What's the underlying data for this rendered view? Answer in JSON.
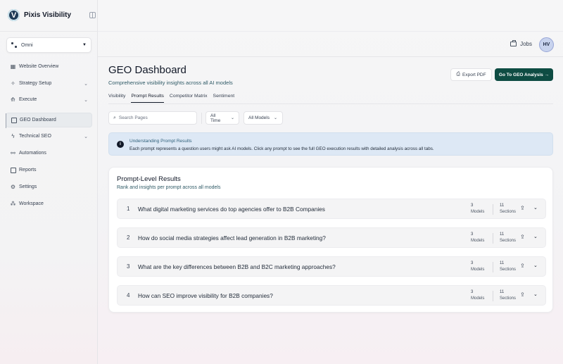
{
  "app": {
    "name": "Pixis Visibility",
    "logo_letter": "V"
  },
  "sidebar": {
    "org": {
      "name": "Omni"
    },
    "items": [
      {
        "label": "Website Overview",
        "icon": "grid-icon"
      },
      {
        "label": "Strategy Setup",
        "icon": "wand-icon",
        "expandable": true
      },
      {
        "label": "Execute",
        "icon": "rocket-icon",
        "expandable": true
      },
      {
        "label": "GEO Dashboard",
        "icon": "dashboard-icon",
        "active": true
      },
      {
        "label": "Technical SEO",
        "icon": "bolt-icon",
        "expandable": true
      },
      {
        "label": "Automations",
        "icon": "automation-icon"
      },
      {
        "label": "Reports",
        "icon": "reports-icon"
      },
      {
        "label": "Settings",
        "icon": "gear-icon"
      },
      {
        "label": "Workspace",
        "icon": "workspace-icon"
      }
    ]
  },
  "topbar": {
    "jobs_label": "Jobs",
    "avatar_initials": "HV"
  },
  "header": {
    "title": "GEO Dashboard",
    "subtitle": "Comprehensive visibility insights across all AI models",
    "export_label": "Export PDF",
    "cta_label": "Go To GEO Analysis →"
  },
  "tabs": [
    {
      "label": "Visibility"
    },
    {
      "label": "Prompt Results",
      "active": true
    },
    {
      "label": "Competitor Matrix"
    },
    {
      "label": "Sentiment"
    }
  ],
  "filters": {
    "search_placeholder": "Search Pages",
    "time": "All Time",
    "models": "All Models"
  },
  "info": {
    "title": "Understanding Prompt Results",
    "text": "Each prompt represents a question users might ask AI models. Click any prompt to see the full GEO execution results with detailed analysis across all tabs."
  },
  "results": {
    "title": "Prompt-Level Results",
    "subtitle": "Rank and insights per prompt across all models",
    "models_label": "Models",
    "sections_label": "Sections",
    "rows": [
      {
        "num": "1",
        "question": "What digital marketing services do top agencies offer to B2B Companies",
        "models": "3",
        "sections": "11"
      },
      {
        "num": "2",
        "question": "How do social media strategies affect lead generation in B2B marketing?",
        "models": "3",
        "sections": "11"
      },
      {
        "num": "3",
        "question": "What are the key differences between B2B and B2C marketing approaches?",
        "models": "3",
        "sections": "11"
      },
      {
        "num": "4",
        "question": "How can SEO improve visibility for B2B companies?",
        "models": "3",
        "sections": "11"
      }
    ]
  }
}
